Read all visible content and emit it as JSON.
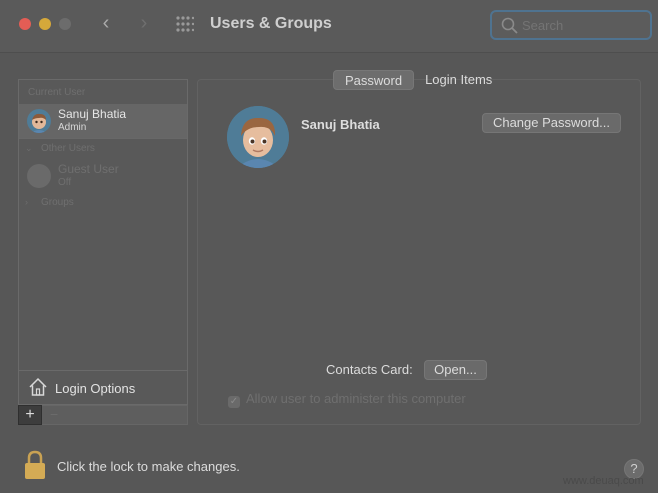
{
  "window": {
    "title": "Users & Groups"
  },
  "search": {
    "placeholder": "Search"
  },
  "sidebar": {
    "current_user_header": "Current User",
    "current_user": {
      "name": "Sanuj Bhatia",
      "role": "Admin"
    },
    "other_users_header": "Other Users",
    "guest_user": {
      "name": "Guest User",
      "status": "Off"
    },
    "groups_label": "Groups",
    "login_options": "Login Options"
  },
  "controls": {
    "add": "+",
    "remove": "−"
  },
  "tabs": [
    {
      "label": "Password",
      "active": true
    },
    {
      "label": "Login Items",
      "active": false
    }
  ],
  "detail": {
    "display_name": "Sanuj Bhatia",
    "change_password": "Change Password...",
    "contacts_card_label": "Contacts Card:",
    "open_button": "Open...",
    "allow_admin_label": "Allow user to administer this computer",
    "allow_admin_checked": true
  },
  "footer": {
    "lock_text": "Click the lock to make changes.",
    "help": "?"
  },
  "watermark": "www.deuaq.com",
  "colors": {
    "focus_ring": "#4f7390",
    "avatar_bg": "#4f7c97"
  }
}
